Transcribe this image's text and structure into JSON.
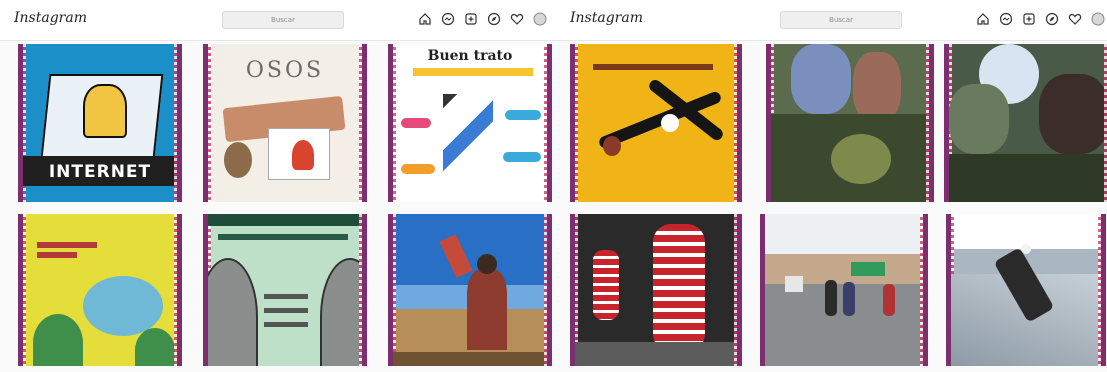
{
  "left": {
    "logo": "Instagram",
    "search_placeholder": "Buscar",
    "icons": [
      "home-icon",
      "messenger-icon",
      "new-post-icon",
      "explore-icon",
      "heart-icon",
      "profile-icon"
    ],
    "posts": [
      {
        "name": "internet-cover",
        "title": "INTERNET",
        "bg": "#1a8fc8"
      },
      {
        "name": "osos-cover",
        "title": "OSOS",
        "bg": "#f3efe6"
      },
      {
        "name": "buen-trato-cover",
        "title": "Buen trato",
        "bg": "#ffffff"
      },
      {
        "name": "yellow-colors-cover",
        "title": "",
        "bg": "#e5dd3a"
      },
      {
        "name": "green-faces-cover",
        "title": "",
        "bg": "#bfe0c8"
      },
      {
        "name": "lake-photo",
        "title": "",
        "bg": "#3b7fc8"
      }
    ]
  },
  "right": {
    "logo": "Instagram",
    "search_placeholder": "Buscar",
    "icons": [
      "home-icon",
      "messenger-icon",
      "new-post-icon",
      "explore-icon",
      "heart-icon",
      "profile-icon"
    ],
    "posts": [
      {
        "name": "condor-cover",
        "title": "",
        "bg": "#f1b417"
      },
      {
        "name": "hands-plants-photo",
        "title": "",
        "bg": "#5b6b4e"
      },
      {
        "name": "group-plants-photo",
        "title": "",
        "bg": "#4a5a48"
      },
      {
        "name": "red-figures-cover",
        "title": "",
        "bg": "#2a2a2a"
      },
      {
        "name": "road-walkers-photo",
        "title": "",
        "bg": "#b9c3c9"
      },
      {
        "name": "condor-flight-photo",
        "title": "",
        "bg": "#aab7c2"
      }
    ]
  }
}
